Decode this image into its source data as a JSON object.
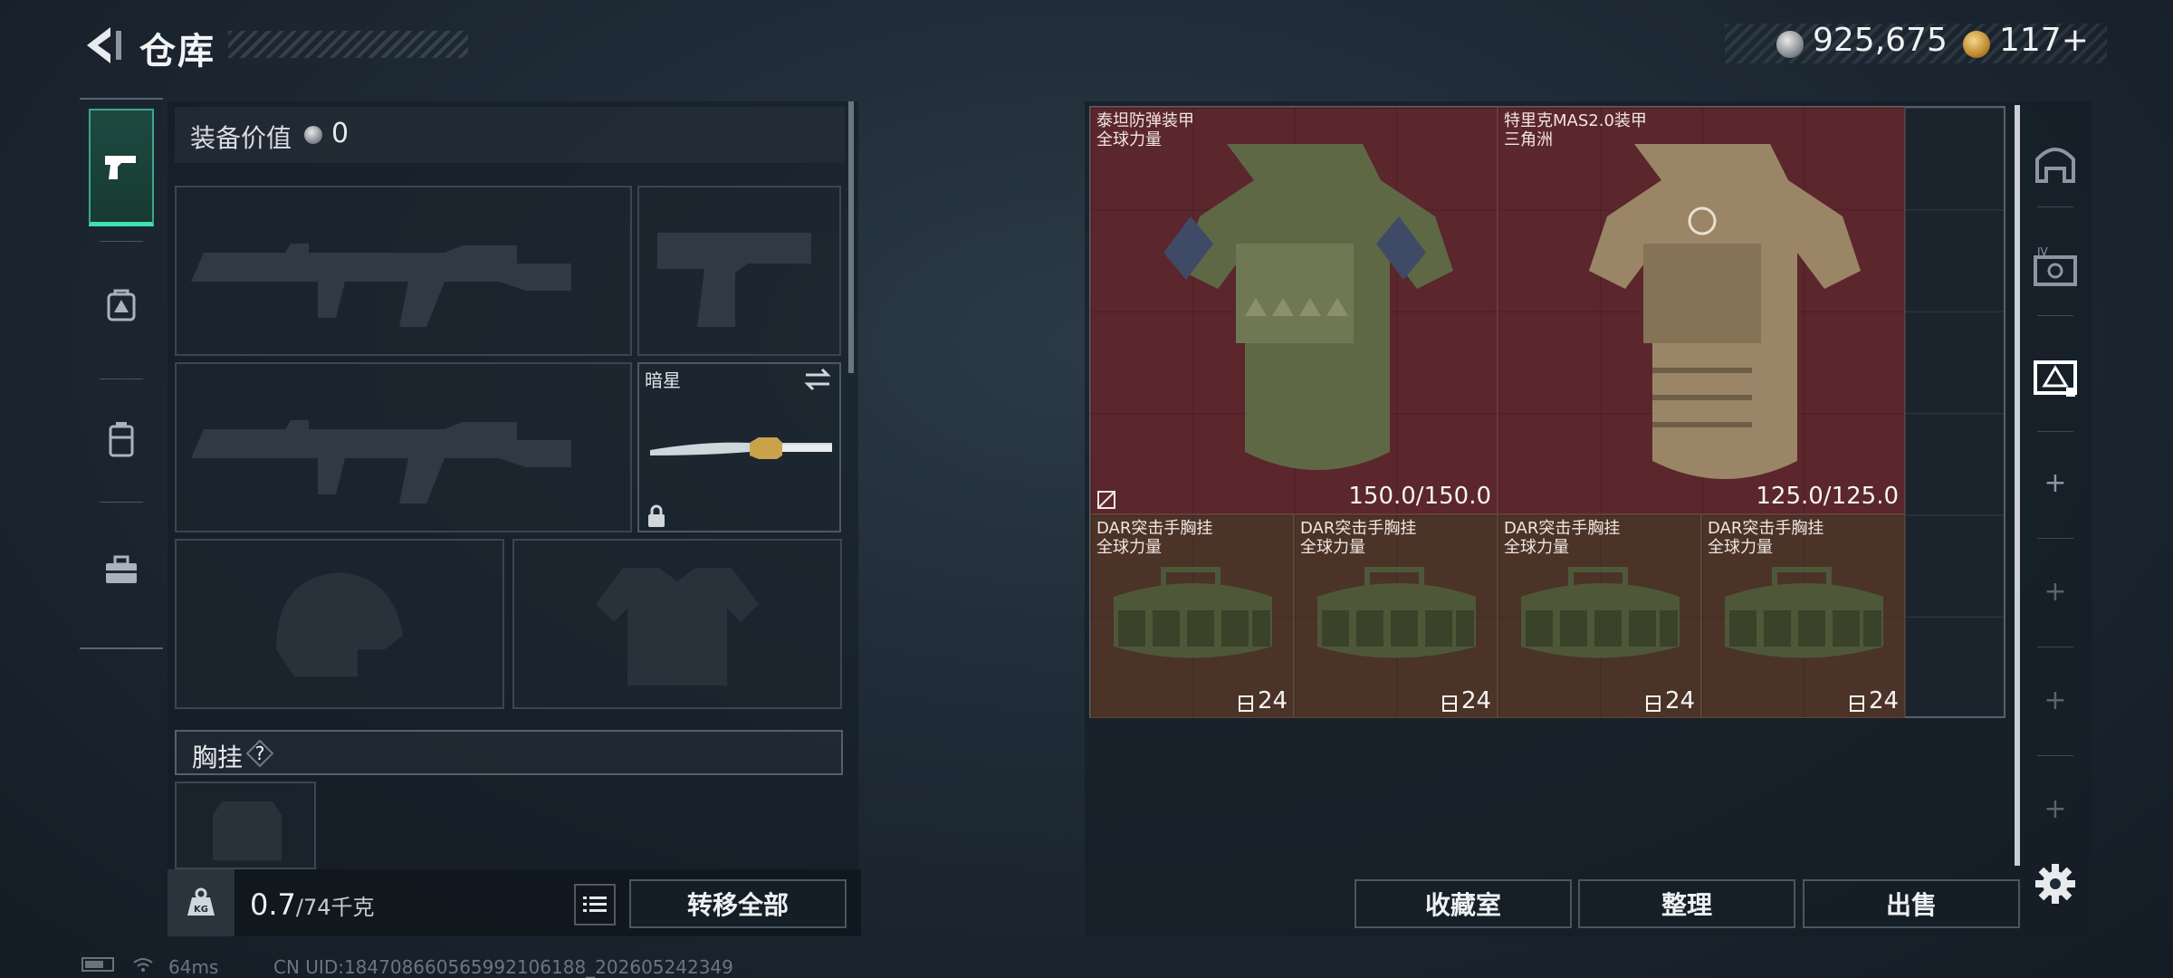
{
  "header": {
    "title": "仓库",
    "currency": {
      "money": "925,675",
      "tickets": "117+"
    }
  },
  "equipment": {
    "value_label": "装备价值",
    "value": "0",
    "knife_name": "暗星",
    "section_label": "胸挂",
    "help_glyph": "?"
  },
  "footer_left": {
    "weight_current": "0.7",
    "weight_max": "/74千克",
    "transfer_all": "转移全部"
  },
  "status": {
    "ping": "64ms",
    "uid": "CN UID:1847086605659921061​88_202605242349"
  },
  "storage": {
    "items": [
      {
        "name": "泰坦防弹装甲",
        "subtitle": "全球力量",
        "durability": "150.0/150.0"
      },
      {
        "name": "特里克MAS2.0装甲",
        "subtitle": "三角洲",
        "durability": "125.0/125.0"
      },
      {
        "name": "DAR突击手胸挂",
        "subtitle": "全球力量",
        "capacity": "24"
      },
      {
        "name": "DAR突击手胸挂",
        "subtitle": "全球力量",
        "capacity": "24"
      },
      {
        "name": "DAR突击手胸挂",
        "subtitle": "全球力量",
        "capacity": "24"
      },
      {
        "name": "DAR突击手胸挂",
        "subtitle": "全球力量",
        "capacity": "24"
      }
    ],
    "tab_plus": "+"
  },
  "actions": {
    "collection": "收藏室",
    "sort": "整理",
    "sell": "出售"
  },
  "colors": {
    "accent": "#3fe0b0",
    "item_red": "#5b262c",
    "item_brown": "#4b3328"
  }
}
